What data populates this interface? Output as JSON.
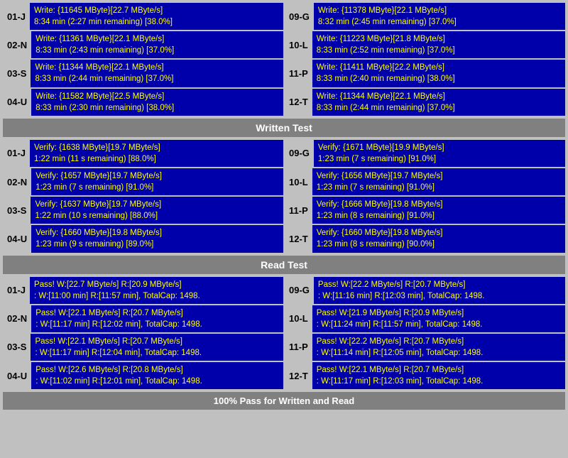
{
  "sections": {
    "write_test": {
      "label": "Written Test",
      "rows": [
        {
          "left": {
            "id": "01-J",
            "line1": "Write: {11645 MByte}[22.7 MByte/s]",
            "line2": "8:34 min (2:27 min remaining)  [38.0%]"
          },
          "right": {
            "id": "09-G",
            "line1": "Write: {11378 MByte}[22.1 MByte/s]",
            "line2": "8:32 min (2:45 min remaining)  [37.0%]"
          }
        },
        {
          "left": {
            "id": "02-N",
            "line1": "Write: {11361 MByte}[22.1 MByte/s]",
            "line2": "8:33 min (2:43 min remaining)  [37.0%]"
          },
          "right": {
            "id": "10-L",
            "line1": "Write: {11223 MByte}[21.8 MByte/s]",
            "line2": "8:33 min (2:52 min remaining)  [37.0%]"
          }
        },
        {
          "left": {
            "id": "03-S",
            "line1": "Write: {11344 MByte}[22.1 MByte/s]",
            "line2": "8:33 min (2:44 min remaining)  [37.0%]"
          },
          "right": {
            "id": "11-P",
            "line1": "Write: {11411 MByte}[22.2 MByte/s]",
            "line2": "8:33 min (2:40 min remaining)  [38.0%]"
          }
        },
        {
          "left": {
            "id": "04-U",
            "line1": "Write: {11582 MByte}[22.5 MByte/s]",
            "line2": "8:33 min (2:30 min remaining)  [38.0%]"
          },
          "right": {
            "id": "12-T",
            "line1": "Write: {11344 MByte}[22.1 MByte/s]",
            "line2": "8:33 min (2:44 min remaining)  [37.0%]"
          }
        }
      ]
    },
    "verify_test": {
      "label": "Written Test",
      "rows": [
        {
          "left": {
            "id": "01-J",
            "line1": "Verify: {1638 MByte}[19.7 MByte/s]",
            "line2": "1:22 min (11 s remaining)  [88.0%]"
          },
          "right": {
            "id": "09-G",
            "line1": "Verify: {1671 MByte}[19.9 MByte/s]",
            "line2": "1:23 min (7 s remaining)  [91.0%]"
          }
        },
        {
          "left": {
            "id": "02-N",
            "line1": "Verify: {1657 MByte}[19.7 MByte/s]",
            "line2": "1:23 min (7 s remaining)  [91.0%]"
          },
          "right": {
            "id": "10-L",
            "line1": "Verify: {1656 MByte}[19.7 MByte/s]",
            "line2": "1:23 min (7 s remaining)  [91.0%]"
          }
        },
        {
          "left": {
            "id": "03-S",
            "line1": "Verify: {1637 MByte}[19.7 MByte/s]",
            "line2": "1:22 min (10 s remaining)  [88.0%]"
          },
          "right": {
            "id": "11-P",
            "line1": "Verify: {1666 MByte}[19.8 MByte/s]",
            "line2": "1:23 min (8 s remaining)  [91.0%]"
          }
        },
        {
          "left": {
            "id": "04-U",
            "line1": "Verify: {1660 MByte}[19.8 MByte/s]",
            "line2": "1:23 min (9 s remaining)  [89.0%]"
          },
          "right": {
            "id": "12-T",
            "line1": "Verify: {1660 MByte}[19.8 MByte/s]",
            "line2": "1:23 min (8 s remaining)  [90.0%]"
          }
        }
      ]
    },
    "read_test": {
      "label": "Read Test",
      "rows": [
        {
          "left": {
            "id": "01-J",
            "line1": "Pass! W:[22.7 MByte/s] R:[20.9 MByte/s]",
            "line2": ": W:[11:00 min] R:[11:57 min], TotalCap: 1498."
          },
          "right": {
            "id": "09-G",
            "line1": "Pass! W:[22.2 MByte/s] R:[20.7 MByte/s]",
            "line2": ": W:[11:16 min] R:[12:03 min], TotalCap: 1498."
          }
        },
        {
          "left": {
            "id": "02-N",
            "line1": "Pass! W:[22.1 MByte/s] R:[20.7 MByte/s]",
            "line2": ": W:[11:17 min] R:[12:02 min], TotalCap: 1498."
          },
          "right": {
            "id": "10-L",
            "line1": "Pass! W:[21.9 MByte/s] R:[20.9 MByte/s]",
            "line2": ": W:[11:24 min] R:[11:57 min], TotalCap: 1498."
          }
        },
        {
          "left": {
            "id": "03-S",
            "line1": "Pass! W:[22.1 MByte/s] R:[20.7 MByte/s]",
            "line2": ": W:[11:17 min] R:[12:04 min], TotalCap: 1498."
          },
          "right": {
            "id": "11-P",
            "line1": "Pass! W:[22.2 MByte/s] R:[20.7 MByte/s]",
            "line2": ": W:[11:14 min] R:[12:05 min], TotalCap: 1498."
          }
        },
        {
          "left": {
            "id": "04-U",
            "line1": "Pass! W:[22.6 MByte/s] R:[20.8 MByte/s]",
            "line2": ": W:[11:02 min] R:[12:01 min], TotalCap: 1498."
          },
          "right": {
            "id": "12-T",
            "line1": "Pass! W:[22.1 MByte/s] R:[20.7 MByte/s]",
            "line2": ": W:[11:17 min] R:[12:03 min], TotalCap: 1498."
          }
        }
      ]
    }
  },
  "footer_label": "100% Pass for Written and Read"
}
